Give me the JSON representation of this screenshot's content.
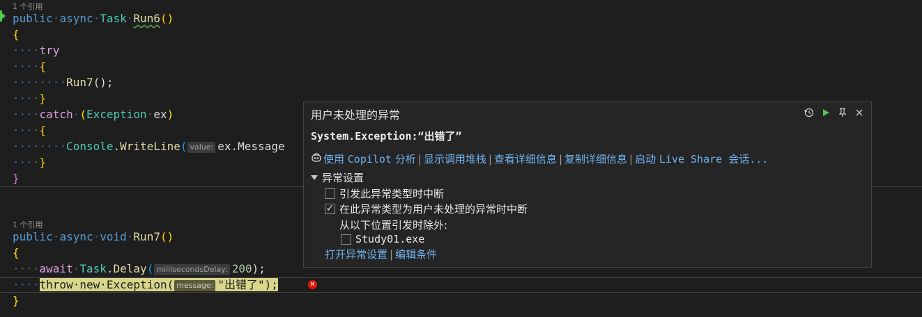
{
  "codelens": {
    "ref1": "1 个引用",
    "ref2": "1 个引用"
  },
  "code": {
    "run6_sig": {
      "kw1": "public",
      "kw2": "async",
      "type": "Task",
      "name": "Run6",
      "parens": "()"
    },
    "open1": "{",
    "try_kw": "try",
    "open2": "{",
    "call_run7": "Run7",
    "call_run7_tail": "();",
    "close2": "}",
    "catch_kw": "catch",
    "catch_open": "(",
    "catch_type": "Exception",
    "catch_var": "ex",
    "catch_close": ")",
    "open3": "{",
    "console": "Console",
    "writeline": "WriteLine",
    "wl_paren": "(",
    "wl_hint": "value:",
    "wl_arg": "ex.Message",
    "close3": "}",
    "close1": "}",
    "run7_sig": {
      "kw1": "public",
      "kw2": "async",
      "kw3": "void",
      "name": "Run7",
      "parens": "()"
    },
    "open4": "{",
    "await_kw": "await",
    "task": "Task",
    "delay": "Delay",
    "delay_paren": "(",
    "delay_hint": "millisecondsDelay:",
    "delay_val": "200",
    "delay_tail": ");",
    "throw_kw": "throw",
    "new_kw": "new",
    "exc_type": "Exception",
    "exc_paren": "(",
    "exc_hint": "message:",
    "exc_str": "\"出错了\"",
    "exc_tail": ");",
    "close4": "}"
  },
  "popup": {
    "title": "用户未处理的异常",
    "message": "System.Exception:“出错了”",
    "links": {
      "copilot_prefix": "使用 ",
      "copilot_word": "Copilot",
      "copilot_suffix": " 分析",
      "callstack": "显示调用堆栈",
      "details": "查看详细信息",
      "copy": "复制详细信息",
      "liveshare_prefix": "启动 ",
      "liveshare_word": "Live Share",
      "liveshare_suffix": " 会话..."
    },
    "settings_header": "异常设置",
    "opt_break_thrown": "引发此异常类型时中断",
    "opt_break_unhandled": "在此异常类型为用户未处理的异常时中断",
    "except_from": "从以下位置引发时除外:",
    "module": "Study01.exe",
    "open_settings": "打开异常设置",
    "edit_conditions": "编辑条件",
    "checkbox_states": {
      "break_thrown": false,
      "break_unhandled": true,
      "module": false
    }
  },
  "icons": [
    "history-icon",
    "continue-icon",
    "pin-icon",
    "close-icon",
    "copilot-icon",
    "error-icon",
    "current-statement-arrow-icon"
  ]
}
